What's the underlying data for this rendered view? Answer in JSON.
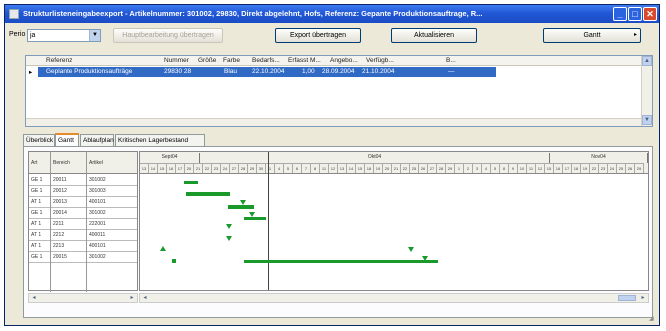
{
  "window": {
    "title": "Strukturlisteneingabeexport - Artikelnummer: 301002, 29830, Direkt abgelehnt, Hofs, Referenz: Gepante Produktionsauftrage, R..."
  },
  "toolbar": {
    "period_label": "Perio",
    "period_value": "ja",
    "disabled_button": "Hauptbearbeitung übertragen",
    "btn_export": "Export übertragen",
    "btn_refresh": "Aktualisieren",
    "btn_close": "Gantt"
  },
  "top_grid": {
    "headers": [
      "Referenz",
      "Nummer",
      "Größe",
      "Farbe",
      "Bedarfs...",
      "Erfasst M...",
      "Angebo...",
      "Verfügb...",
      "B..."
    ],
    "row": {
      "referenz": "Geplante Produktionsaufträge",
      "nummer": "29830 28",
      "groesse": "",
      "farbe": "Blau",
      "bedarf": "22.10.2004",
      "erfasst": "1,00",
      "angebot": "28.09.2004",
      "verfuegbar": "21.10.2004",
      "b": "—"
    }
  },
  "tabs": [
    "Überblick",
    "Gantt",
    "Ablaufplan",
    "Kritischen Lagerbestand"
  ],
  "active_tab": "Gantt",
  "gantt": {
    "left_headers": [
      "Art",
      "Bereich",
      "Artikel"
    ],
    "rows": [
      {
        "c1": "GE 1",
        "c2": "20011",
        "c3": "301002"
      },
      {
        "c1": "GE 1",
        "c2": "20012",
        "c3": "301003"
      },
      {
        "c1": "AT 1",
        "c2": "20013",
        "c3": "400101"
      },
      {
        "c1": "GE 1",
        "c2": "20014",
        "c3": "301002"
      },
      {
        "c1": "AT 1",
        "c2": "2211",
        "c3": "222001"
      },
      {
        "c1": "AT 1",
        "c2": "2212",
        "c3": "400011"
      },
      {
        "c1": "AT 1",
        "c2": "2213",
        "c3": "400101"
      },
      {
        "c1": "GE 1",
        "c2": "20015",
        "c3": "301002"
      }
    ],
    "months": [
      "Sept04",
      "Okt04",
      "Nov04"
    ],
    "days": [
      "13",
      "14",
      "15",
      "16",
      "17",
      "20",
      "21",
      "22",
      "23",
      "24",
      "27",
      "28",
      "29",
      "30",
      "1",
      "4",
      "5",
      "6",
      "7",
      "8",
      "11",
      "12",
      "13",
      "14",
      "15",
      "18",
      "19",
      "20",
      "21",
      "22",
      "25",
      "26",
      "27",
      "28",
      "29",
      "1",
      "2",
      "3",
      "4",
      "5",
      "8",
      "9",
      "10",
      "11",
      "12",
      "15",
      "16",
      "17",
      "18",
      "19",
      "22",
      "23",
      "24",
      "25",
      "26",
      "29"
    ]
  },
  "colors": {
    "title_blue": "#2158d6",
    "selection_blue": "#316ac5",
    "gantt_green": "#1a9a2a",
    "active_tab_accent": "#e68b2c"
  }
}
